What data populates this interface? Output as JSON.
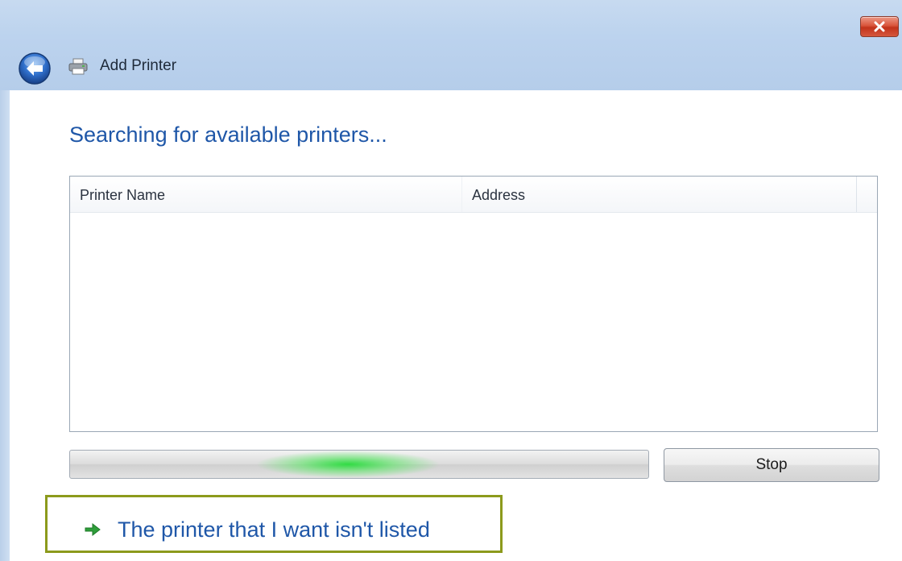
{
  "window": {
    "title": "Add Printer"
  },
  "main": {
    "heading": "Searching for available printers..."
  },
  "printer_list": {
    "columns": [
      "Printer Name",
      "Address"
    ],
    "rows": []
  },
  "progress": {
    "indeterminate": true,
    "glow_position": 0.32
  },
  "actions": {
    "stop_label": "Stop",
    "not_listed_label": "The printer that I want isn't listed"
  },
  "icons": {
    "back": "back-arrow-icon",
    "printer": "printer-icon",
    "close": "close-icon",
    "link_arrow": "green-arrow-icon"
  },
  "colors": {
    "heading": "#1f57a8",
    "link": "#1f57a8",
    "highlight_border": "#8c9a1c",
    "progress_glow": "#28dc3c",
    "close_button": "#d5573d"
  }
}
